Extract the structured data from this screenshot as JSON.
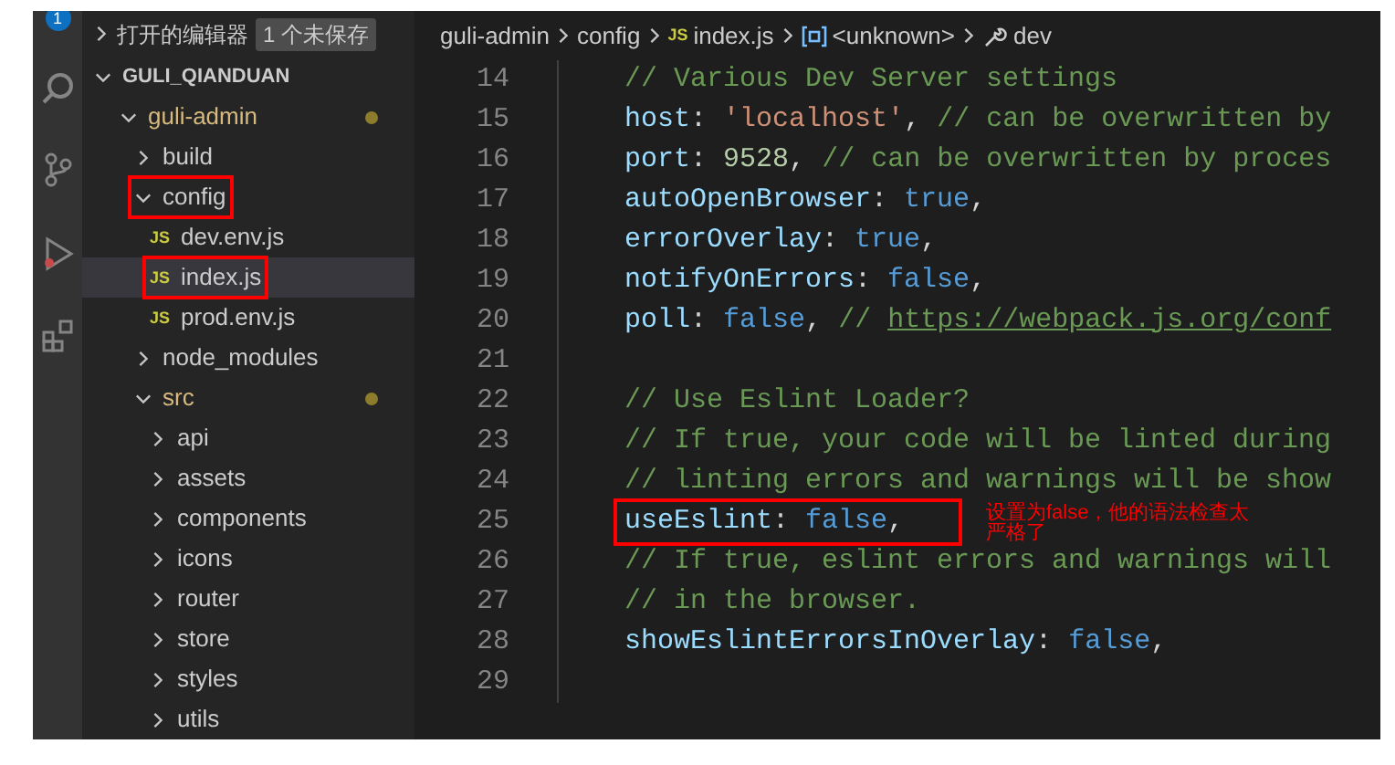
{
  "activity_bar": {
    "badge": "1"
  },
  "explorer": {
    "open_editors": {
      "label": "打开的编辑器",
      "badge": "1 个未保存",
      "expanded": false
    },
    "tree": [
      {
        "label": "GULI_QIANDUAN",
        "kind": "root",
        "expanded": true,
        "children": [
          {
            "label": "guli-admin",
            "kind": "folder",
            "expanded": true,
            "modified": true,
            "children": [
              {
                "label": "build",
                "kind": "folder",
                "expanded": false
              },
              {
                "label": "config",
                "kind": "folder",
                "expanded": true,
                "boxed": true,
                "children": [
                  {
                    "label": "dev.env.js",
                    "kind": "file",
                    "icon": "JS",
                    "selected": false
                  },
                  {
                    "label": "index.js",
                    "kind": "file",
                    "icon": "JS",
                    "selected": true,
                    "boxed": true
                  },
                  {
                    "label": "prod.env.js",
                    "kind": "file",
                    "icon": "JS",
                    "selected": false
                  }
                ]
              },
              {
                "label": "node_modules",
                "kind": "folder",
                "expanded": false
              },
              {
                "label": "src",
                "kind": "folder",
                "expanded": true,
                "modified": true,
                "children": [
                  {
                    "label": "api",
                    "kind": "folder",
                    "expanded": false
                  },
                  {
                    "label": "assets",
                    "kind": "folder",
                    "expanded": false
                  },
                  {
                    "label": "components",
                    "kind": "folder",
                    "expanded": false
                  },
                  {
                    "label": "icons",
                    "kind": "folder",
                    "expanded": false
                  },
                  {
                    "label": "router",
                    "kind": "folder",
                    "expanded": false
                  },
                  {
                    "label": "store",
                    "kind": "folder",
                    "expanded": false
                  },
                  {
                    "label": "styles",
                    "kind": "folder",
                    "expanded": false
                  },
                  {
                    "label": "utils",
                    "kind": "folder",
                    "expanded": false
                  }
                ]
              }
            ]
          }
        ]
      }
    ]
  },
  "breadcrumb": [
    {
      "label": "guli-admin",
      "kind": "folder"
    },
    {
      "label": "config",
      "kind": "folder"
    },
    {
      "label": "index.js",
      "kind": "js",
      "icon": "JS"
    },
    {
      "label": "<unknown>",
      "kind": "symbol"
    },
    {
      "label": "dev",
      "kind": "wrench"
    }
  ],
  "code_lines": [
    {
      "number": "14",
      "tokens": [
        {
          "kind": "comment",
          "text": "// Various Dev Server settings"
        }
      ]
    },
    {
      "number": "15",
      "tokens": [
        {
          "kind": "key",
          "text": "host"
        },
        {
          "kind": "punct",
          "text": ": "
        },
        {
          "kind": "string",
          "text": "'localhost'"
        },
        {
          "kind": "punct",
          "text": ", "
        },
        {
          "kind": "comment",
          "text": "// can be overwritten by"
        }
      ]
    },
    {
      "number": "16",
      "tokens": [
        {
          "kind": "key",
          "text": "port"
        },
        {
          "kind": "punct",
          "text": ": "
        },
        {
          "kind": "number",
          "text": "9528"
        },
        {
          "kind": "punct",
          "text": ", "
        },
        {
          "kind": "comment",
          "text": "// can be overwritten by proces"
        }
      ]
    },
    {
      "number": "17",
      "tokens": [
        {
          "kind": "key",
          "text": "autoOpenBrowser"
        },
        {
          "kind": "punct",
          "text": ": "
        },
        {
          "kind": "keyword",
          "text": "true"
        },
        {
          "kind": "punct",
          "text": ","
        }
      ]
    },
    {
      "number": "18",
      "tokens": [
        {
          "kind": "key",
          "text": "errorOverlay"
        },
        {
          "kind": "punct",
          "text": ": "
        },
        {
          "kind": "keyword",
          "text": "true"
        },
        {
          "kind": "punct",
          "text": ","
        }
      ]
    },
    {
      "number": "19",
      "tokens": [
        {
          "kind": "key",
          "text": "notifyOnErrors"
        },
        {
          "kind": "punct",
          "text": ": "
        },
        {
          "kind": "keyword",
          "text": "false"
        },
        {
          "kind": "punct",
          "text": ","
        }
      ]
    },
    {
      "number": "20",
      "tokens": [
        {
          "kind": "key",
          "text": "poll"
        },
        {
          "kind": "punct",
          "text": ": "
        },
        {
          "kind": "keyword",
          "text": "false"
        },
        {
          "kind": "punct",
          "text": ", "
        },
        {
          "kind": "comment",
          "text": "// "
        },
        {
          "kind": "link",
          "text": "https://webpack.js.org/conf"
        }
      ]
    },
    {
      "number": "21"
    },
    {
      "number": "22",
      "tokens": [
        {
          "kind": "comment",
          "text": "// Use Eslint Loader?"
        }
      ]
    },
    {
      "number": "23",
      "tokens": [
        {
          "kind": "comment",
          "text": "// If true, your code will be linted during"
        }
      ]
    },
    {
      "number": "24",
      "tokens": [
        {
          "kind": "comment",
          "text": "// linting errors and warnings will be show"
        }
      ]
    },
    {
      "number": "25",
      "boxed": true,
      "tokens": [
        {
          "kind": "key",
          "text": "useEslint"
        },
        {
          "kind": "punct",
          "text": ": "
        },
        {
          "kind": "keyword",
          "text": "false"
        },
        {
          "kind": "punct",
          "text": ","
        }
      ]
    },
    {
      "number": "26",
      "tokens": [
        {
          "kind": "comment",
          "text": "// If true, eslint errors and warnings will"
        }
      ]
    },
    {
      "number": "27",
      "tokens": [
        {
          "kind": "comment",
          "text": "// in the browser."
        }
      ]
    },
    {
      "number": "28",
      "tokens": [
        {
          "kind": "key",
          "text": "showEslintErrorsInOverlay"
        },
        {
          "kind": "punct",
          "text": ": "
        },
        {
          "kind": "keyword",
          "text": "false"
        },
        {
          "kind": "punct",
          "text": ","
        }
      ]
    },
    {
      "number": "29"
    }
  ],
  "annotation": {
    "text": "设置为false，他的语法检查太严格了"
  }
}
